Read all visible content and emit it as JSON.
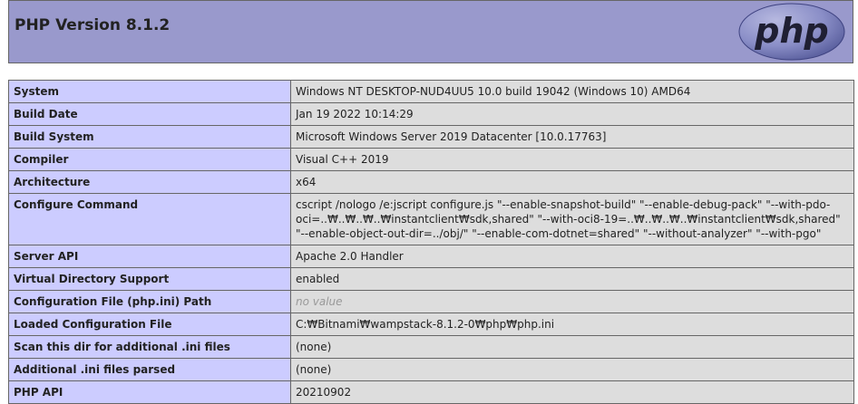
{
  "header": {
    "title": "PHP Version 8.1.2",
    "logo_text": "php"
  },
  "rows": [
    {
      "label": "System",
      "value": "Windows NT DESKTOP-NUD4UU5 10.0 build 19042 (Windows 10) AMD64"
    },
    {
      "label": "Build Date",
      "value": "Jan 19 2022 10:14:29"
    },
    {
      "label": "Build System",
      "value": "Microsoft Windows Server 2019 Datacenter [10.0.17763]"
    },
    {
      "label": "Compiler",
      "value": "Visual C++ 2019"
    },
    {
      "label": "Architecture",
      "value": "x64"
    },
    {
      "label": "Configure Command",
      "value": "cscript /nologo /e:jscript configure.js \"--enable-snapshot-build\" \"--enable-debug-pack\" \"--with-pdo-oci=..₩..₩..₩..₩instantclient₩sdk,shared\" \"--with-oci8-19=..₩..₩..₩..₩instantclient₩sdk,shared\" \"--enable-object-out-dir=../obj/\" \"--enable-com-dotnet=shared\" \"--without-analyzer\" \"--with-pgo\""
    },
    {
      "label": "Server API",
      "value": "Apache 2.0 Handler"
    },
    {
      "label": "Virtual Directory Support",
      "value": "enabled"
    },
    {
      "label": "Configuration File (php.ini) Path",
      "value": "no value"
    },
    {
      "label": "Loaded Configuration File",
      "value": "C:₩Bitnami₩wampstack-8.1.2-0₩php₩php.ini"
    },
    {
      "label": "Scan this dir for additional .ini files",
      "value": "(none)"
    },
    {
      "label": "Additional .ini files parsed",
      "value": "(none)"
    },
    {
      "label": "PHP API",
      "value": "20210902"
    }
  ]
}
